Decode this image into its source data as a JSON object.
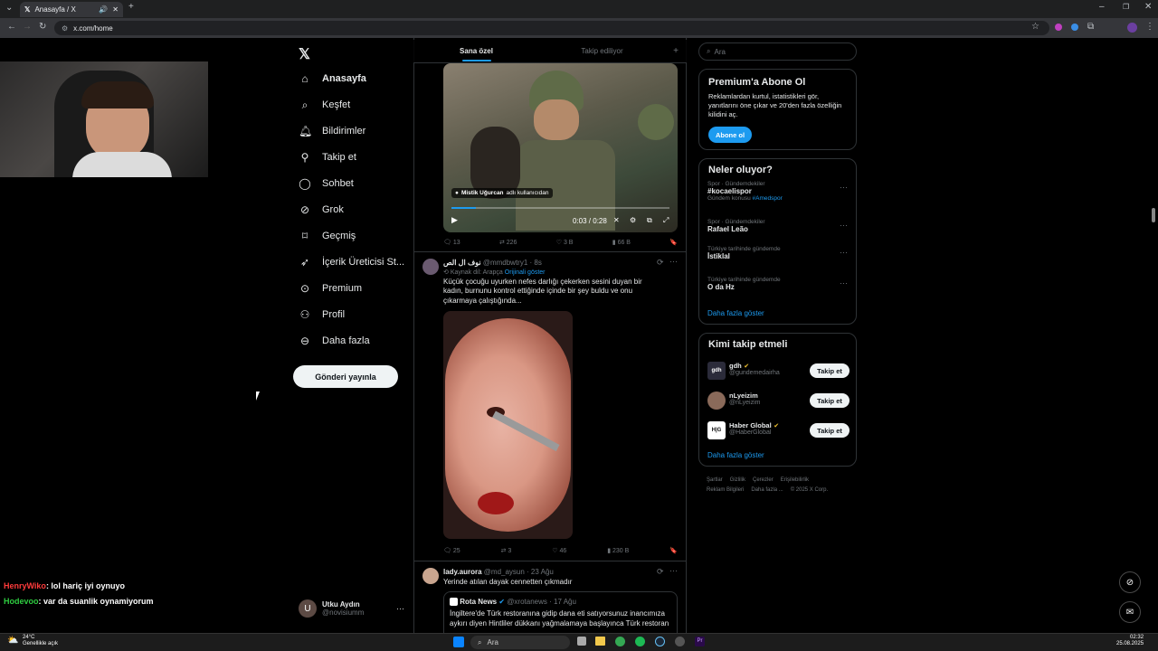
{
  "browser": {
    "tab_title": "Anasayfa / X",
    "url": "x.com/home"
  },
  "nav": {
    "items": [
      {
        "label": "Anasayfa",
        "icon": "home-icon",
        "active": true
      },
      {
        "label": "Keşfet",
        "icon": "search-icon"
      },
      {
        "label": "Bildirimler",
        "icon": "bell-icon"
      },
      {
        "label": "Takip et",
        "icon": "person-plus-icon"
      },
      {
        "label": "Sohbet",
        "icon": "chat-icon"
      },
      {
        "label": "Grok",
        "icon": "grok-icon"
      },
      {
        "label": "Geçmiş",
        "icon": "bookmark-icon"
      },
      {
        "label": "İçerik Üreticisi St...",
        "icon": "rocket-icon"
      },
      {
        "label": "Premium",
        "icon": "premium-icon"
      },
      {
        "label": "Profil",
        "icon": "profile-icon"
      },
      {
        "label": "Daha fazla",
        "icon": "more-icon"
      }
    ],
    "post_button": "Gönderi yayınla",
    "account": {
      "name": "Utku Aydın",
      "handle": "@novisiumm",
      "initial": "U"
    }
  },
  "feed": {
    "tabs": [
      "Sana özel",
      "Takip ediliyor"
    ],
    "video": {
      "tag": "Mistik Uğurcan",
      "tag_suffix": "adlı kullanıcıdan",
      "time": "0:03 / 0:28",
      "stats": [
        "13",
        "226",
        "3 B",
        "66 B"
      ]
    },
    "tweet1": {
      "name": "نوف ال الص",
      "handle": "@mmdbwtry1",
      "time": "8s",
      "translation": "Kaynak dil: Arapça",
      "show_original": "Orijinali göster",
      "text": "Küçük çocuğu uyurken nefes darlığı çekerken sesini duyan bir kadın, burnunu kontrol ettiğinde içinde bir şey buldu ve onu çıkarmaya çalıştığında...",
      "stats": [
        "25",
        "3",
        "46",
        "230 B"
      ]
    },
    "tweet2": {
      "name": "lady.aurora",
      "handle": "@md_aysun",
      "time": "23 Ağu",
      "text": "Yerinde atılan dayak cennetten çıkmadır",
      "quote_name": "Rota News",
      "quote_handle": "@xrotanews",
      "quote_time": "17 Ağu",
      "quote_text": "İngiltere'de Türk restoranına gidip dana eti satıyorsunuz inancımıza aykırı diyen Hintliler dükkanı yağmalamaya başlayınca Türk restoran"
    }
  },
  "right": {
    "search_placeholder": "Ara",
    "premium": {
      "title": "Premium'a Abone Ol",
      "text": "Reklamlardan kurtul, istatistikleri gör, yanıtlarını öne çıkar ve 20'den fazla özelliğin kilidini aç.",
      "button": "Abone ol"
    },
    "trends": {
      "title": "Neler oluyor?",
      "items": [
        {
          "cat": "Spor · Gündemdekiler",
          "name": "#kocaelispor",
          "extra": "Gündem konusu",
          "extra_link": "#Amedspor"
        },
        {
          "cat": "Spor · Gündemdekiler",
          "name": "Rafael Leão"
        },
        {
          "cat": "Türkiye tarihinde gündemde",
          "name": "İstiklal"
        },
        {
          "cat": "Türkiye tarihinde gündemde",
          "name": "O da Hz"
        }
      ],
      "show_more": "Daha fazla göster"
    },
    "who_to_follow": {
      "title": "Kimi takip etmeli",
      "items": [
        {
          "name": "gdh",
          "handle": "@gundemedairha",
          "avatar": "gdh",
          "verified": true
        },
        {
          "name": "nLyeizim",
          "handle": "@nLyeizim",
          "avatar": "",
          "verified": false
        },
        {
          "name": "Haber Global",
          "handle": "@HaberGlobal",
          "avatar": "H|G",
          "verified": true
        }
      ],
      "follow_label": "Takip et",
      "show_more": "Daha fazla göster"
    },
    "footer": [
      "Şartlar",
      "Gizlilik",
      "Çerezler",
      "Erişilebilirlik",
      "Reklam Bilgileri",
      "Daha fazla ...",
      "© 2025 X Corp."
    ]
  },
  "chat": [
    {
      "user": "HenryWiko",
      "color": "#ff3b3b",
      "msg": ": lol hariç iyi oynuyo"
    },
    {
      "user": "Hodevoo",
      "color": "#2ecc40",
      "msg": ": var da suanlik oynamiyorum"
    }
  ],
  "taskbar": {
    "weather": "24°C",
    "weather_desc": "Genellikle açık",
    "search": "Ara",
    "time": "02:32",
    "date": "25.08.2025"
  }
}
